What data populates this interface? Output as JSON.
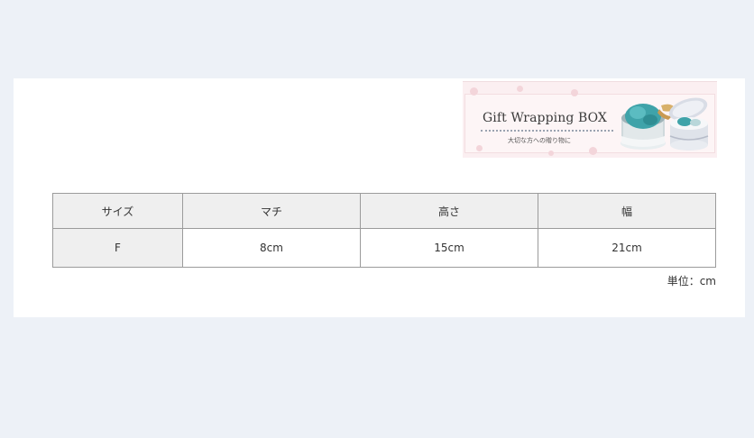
{
  "banner": {
    "title": "Gift Wrapping BOX",
    "subtitle": "大切な方への贈り物に"
  },
  "spec_table": {
    "headers": [
      "サイズ",
      "マチ",
      "高さ",
      "幅"
    ],
    "rows": [
      [
        "F",
        "8cm",
        "15cm",
        "21cm"
      ]
    ]
  },
  "unit_note": "単位：cm",
  "colors": {
    "page_background": "#edf1f7",
    "panel_background": "#ffffff",
    "header_cell_background": "#efefef",
    "table_border": "#9b9b9b",
    "banner_pink": "#fbeff1",
    "box_teal": "#3fa3a9"
  }
}
